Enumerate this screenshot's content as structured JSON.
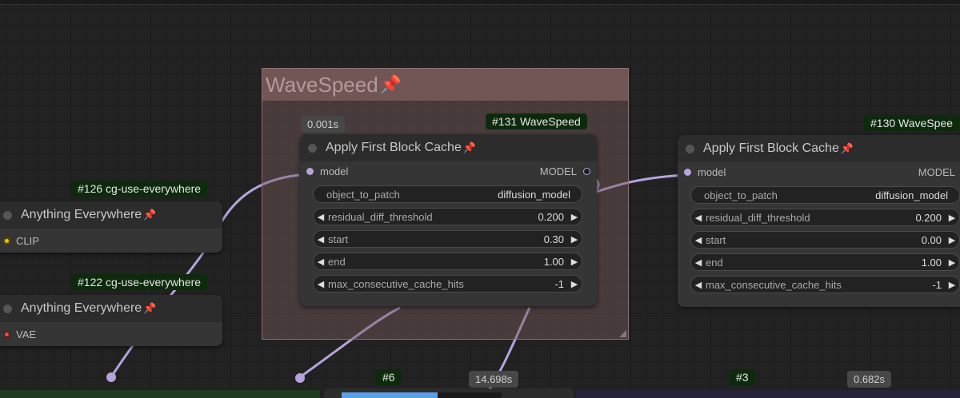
{
  "colors": {
    "wire": "#b7a3dc",
    "badge_bg": "#0d2a0d",
    "group_bg": "#7a5a5a",
    "clip_port": "#e8c300",
    "vae_port": "#e85050",
    "progress": "#5aa0e6"
  },
  "group": {
    "title": "WaveSpeed",
    "pin_icon": "pushpin-icon"
  },
  "node131": {
    "badge": "#131 WaveSpeed",
    "time": "0.001s",
    "title": "Apply First Block Cache",
    "input_label": "model",
    "output_label": "MODEL",
    "widgets": [
      {
        "label": "object_to_patch",
        "value": "diffusion_model",
        "kind": "combo"
      },
      {
        "label": "residual_diff_threshold",
        "value": "0.200",
        "kind": "number"
      },
      {
        "label": "start",
        "value": "0.30",
        "kind": "number"
      },
      {
        "label": "end",
        "value": "1.00",
        "kind": "number"
      },
      {
        "label": "max_consecutive_cache_hits",
        "value": "-1",
        "kind": "number"
      }
    ]
  },
  "node130": {
    "badge": "#130 WaveSpee",
    "title": "Apply First Block Cache",
    "input_label": "model",
    "output_label": "MODEL",
    "widgets": [
      {
        "label": "object_to_patch",
        "value": "diffusion_model",
        "kind": "combo"
      },
      {
        "label": "residual_diff_threshold",
        "value": "0.200",
        "kind": "number"
      },
      {
        "label": "start",
        "value": "0.00",
        "kind": "number"
      },
      {
        "label": "end",
        "value": "1.00",
        "kind": "number"
      },
      {
        "label": "max_consecutive_cache_hits",
        "value": "-1",
        "kind": "number"
      }
    ]
  },
  "node126": {
    "badge": "#126 cg-use-everywhere",
    "title": "Anything Everywhere",
    "input_label": "CLIP"
  },
  "node122": {
    "badge": "#122 cg-use-everywhere",
    "title": "Anything Everywhere",
    "input_label": "VAE"
  },
  "bottom": {
    "badge6": "#6",
    "time6": "14.698s",
    "badge3": "#3",
    "time3": "0.682s",
    "progress": 0.6
  },
  "glyphs": {
    "left_arrow": "◀",
    "right_arrow": "▶",
    "pin": "📌"
  }
}
